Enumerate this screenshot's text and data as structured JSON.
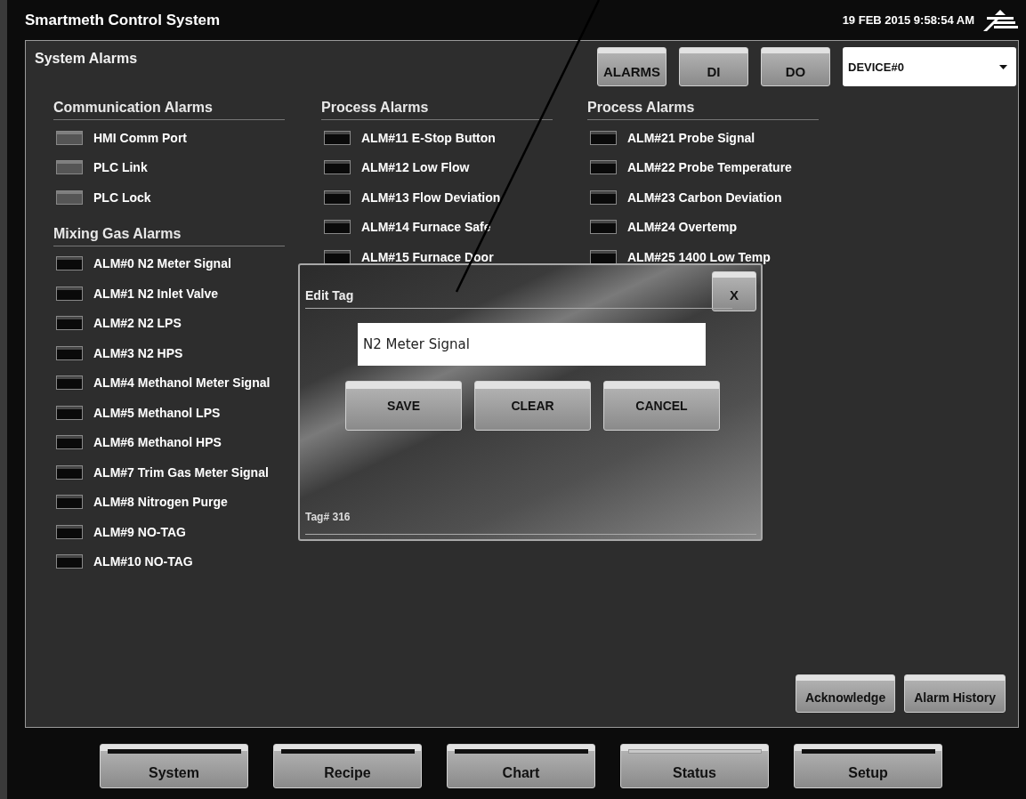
{
  "window": {
    "title": "Smartmeth Control System",
    "datetime": "19 FEB 2015 9:58:54 AM"
  },
  "panel": {
    "title": "System Alarms",
    "view_buttons": [
      "ALARMS",
      "DI",
      "DO"
    ],
    "device_select": {
      "value": "DEVICE#0"
    }
  },
  "columns": [
    {
      "groups": [
        {
          "title": "Communication Alarms",
          "alarms": [
            {
              "label": "HMI Comm Port",
              "color": "#555555"
            },
            {
              "label": "PLC Link",
              "color": "#555555"
            },
            {
              "label": "PLC Lock",
              "color": "#555555"
            }
          ]
        },
        {
          "title": "Mixing Gas Alarms",
          "alarms": [
            {
              "label": "ALM#0 N2 Meter Signal",
              "color": "#0a0a0a"
            },
            {
              "label": "ALM#1 N2 Inlet Valve",
              "color": "#0a0a0a"
            },
            {
              "label": "ALM#2 N2 LPS",
              "color": "#0a0a0a"
            },
            {
              "label": "ALM#3 N2 HPS",
              "color": "#0a0a0a"
            },
            {
              "label": "ALM#4 Methanol Meter Signal",
              "color": "#0a0a0a"
            },
            {
              "label": "ALM#5 Methanol LPS",
              "color": "#0a0a0a"
            },
            {
              "label": "ALM#6 Methanol HPS",
              "color": "#0a0a0a"
            },
            {
              "label": "ALM#7 Trim Gas Meter Signal",
              "color": "#0a0a0a"
            },
            {
              "label": "ALM#8 Nitrogen Purge",
              "color": "#0a0a0a"
            },
            {
              "label": "ALM#9 NO-TAG",
              "color": "#0a0a0a"
            },
            {
              "label": "ALM#10 NO-TAG",
              "color": "#0a0a0a"
            }
          ]
        }
      ]
    },
    {
      "groups": [
        {
          "title": "Process Alarms",
          "alarms": [
            {
              "label": "ALM#11 E-Stop Button",
              "color": "#0a0a0a"
            },
            {
              "label": "ALM#12 Low Flow",
              "color": "#0a0a0a"
            },
            {
              "label": "ALM#13 Flow Deviation",
              "color": "#0a0a0a"
            },
            {
              "label": "ALM#14 Furnace Safe",
              "color": "#0a0a0a"
            },
            {
              "label": "ALM#15 Furnace Door",
              "color": "#0a0a0a"
            }
          ]
        }
      ]
    },
    {
      "groups": [
        {
          "title": "Process Alarms",
          "alarms": [
            {
              "label": "ALM#21 Probe Signal",
              "color": "#0a0a0a"
            },
            {
              "label": "ALM#22 Probe Temperature",
              "color": "#0a0a0a"
            },
            {
              "label": "ALM#23 Carbon Deviation",
              "color": "#0a0a0a"
            },
            {
              "label": "ALM#24 Overtemp",
              "color": "#0a0a0a"
            },
            {
              "label": "ALM#25 1400 Low Temp",
              "color": "#0a0a0a"
            }
          ]
        }
      ]
    }
  ],
  "dialog": {
    "title": "Edit Tag",
    "close": "X",
    "value": "N2 Meter Signal",
    "buttons": [
      "SAVE",
      "CLEAR",
      "CANCEL"
    ],
    "footer": "Tag# 316"
  },
  "actions": [
    "Acknowledge",
    "Alarm History"
  ],
  "nav": [
    {
      "label": "System",
      "selected": false
    },
    {
      "label": "Recipe",
      "selected": false
    },
    {
      "label": "Chart",
      "selected": false
    },
    {
      "label": "Status",
      "selected": true
    },
    {
      "label": "Setup",
      "selected": false
    }
  ]
}
